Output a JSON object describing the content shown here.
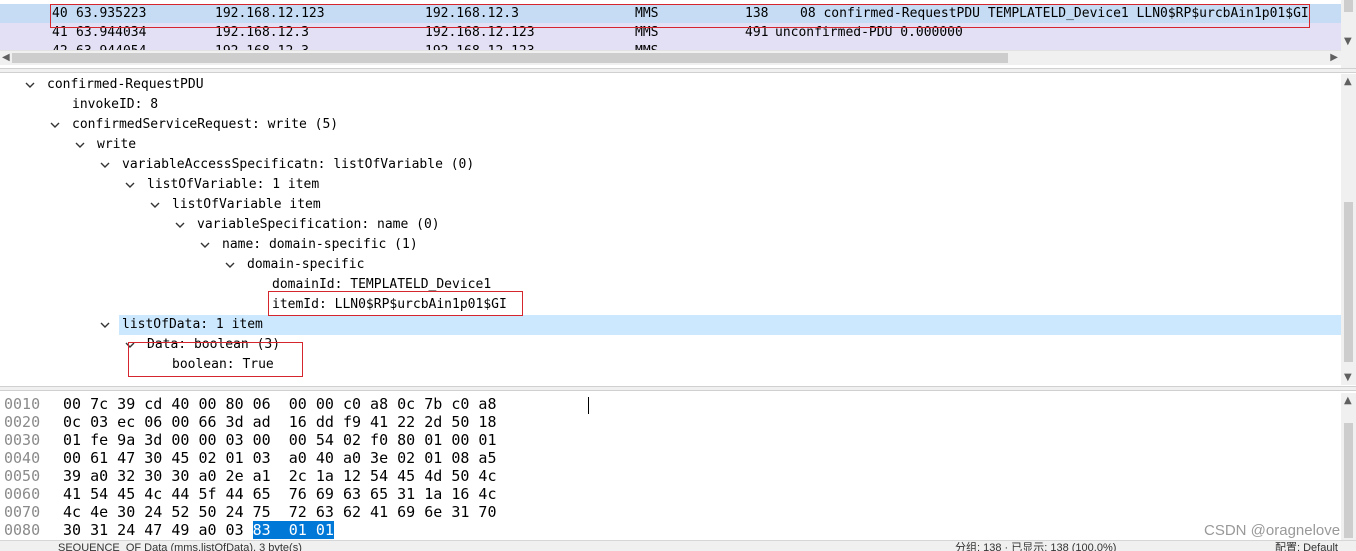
{
  "packet_list": {
    "rows": [
      {
        "no": "40",
        "time": "63.935223",
        "src": "192.168.12.123",
        "dst": "192.168.12.3",
        "proto": "MMS",
        "len": "138",
        "info": "08 confirmed-RequestPDU TEMPLATELD_Device1 LLN0$RP$urcbAin1p01$GI"
      },
      {
        "no": "41",
        "time": "63.944034",
        "src": "192.168.12.3",
        "dst": "192.168.12.123",
        "proto": "MMS",
        "len": "491",
        "info": "unconfirmed-PDU 0.000000"
      },
      {
        "no": "42",
        "time": "63.944054",
        "src": "192.168.12.3",
        "dst": "192.168.12.123",
        "proto": "MMS",
        "len": "",
        "info": ""
      }
    ]
  },
  "details": {
    "rows": [
      {
        "text": "confirmed-RequestPDU",
        "expanded": true
      },
      {
        "text": "invokeID: 8",
        "expanded": null
      },
      {
        "text": "confirmedServiceRequest: write (5)",
        "expanded": true
      },
      {
        "text": "write",
        "expanded": true
      },
      {
        "text": "variableAccessSpecificatn: listOfVariable (0)",
        "expanded": true
      },
      {
        "text": "listOfVariable: 1 item",
        "expanded": true
      },
      {
        "text": "listOfVariable item",
        "expanded": true
      },
      {
        "text": "variableSpecification: name (0)",
        "expanded": true
      },
      {
        "text": "name: domain-specific (1)",
        "expanded": true
      },
      {
        "text": "domain-specific",
        "expanded": true
      },
      {
        "text": "domainId: TEMPLATELD_Device1",
        "expanded": null
      },
      {
        "text": "itemId: LLN0$RP$urcbAin1p01$GI",
        "expanded": null
      },
      {
        "text": "listOfData: 1 item",
        "expanded": true
      },
      {
        "text": "Data: boolean (3)",
        "expanded": true
      },
      {
        "text": "boolean: True",
        "expanded": null
      }
    ],
    "selected_index": 12
  },
  "hex": {
    "rows": [
      {
        "offset": "0010",
        "bytes": "00 7c 39 cd 40 00 80 06  00 00 c0 a8 0c 7b c0 a8",
        "sel": ""
      },
      {
        "offset": "0020",
        "bytes": "0c 03 ec 06 00 66 3d ad  16 dd f9 41 22 2d 50 18",
        "sel": ""
      },
      {
        "offset": "0030",
        "bytes": "01 fe 9a 3d 00 00 03 00  00 54 02 f0 80 01 00 01",
        "sel": ""
      },
      {
        "offset": "0040",
        "bytes": "00 61 47 30 45 02 01 03  a0 40 a0 3e 02 01 08 a5",
        "sel": ""
      },
      {
        "offset": "0050",
        "bytes": "39 a0 32 30 30 a0 2e a1  2c 1a 12 54 45 4d 50 4c",
        "sel": ""
      },
      {
        "offset": "0060",
        "bytes": "41 54 45 4c 44 5f 44 65  76 69 63 65 31 1a 16 4c",
        "sel": ""
      },
      {
        "offset": "0070",
        "bytes": "4c 4e 30 24 52 50 24 75  72 63 62 41 69 6e 31 70",
        "sel": ""
      },
      {
        "offset": "0080",
        "bytes": "30 31 24 47 49 a0 03 ",
        "sel": "83  01 01"
      }
    ]
  },
  "statusbar": {
    "left": "SEQUENCE_OF Data (mms.listOfData), 3 byte(s)",
    "middle": "分组: 138 · 已显示: 138 (100.0%)",
    "right": "配置: Default"
  },
  "watermark": "CSDN @oragnelove",
  "colors": {
    "selected_packet": "#c5dcf4",
    "other_packet": "#e3e0f5",
    "selected_tree": "#cce8ff",
    "hex_selection": "#0078d7",
    "highlight_box": "#d6262d"
  }
}
